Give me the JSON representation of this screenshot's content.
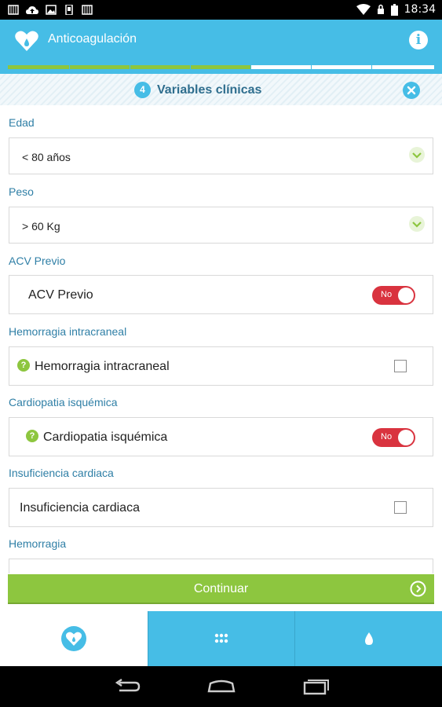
{
  "status_bar": {
    "time": "18:34"
  },
  "app_bar": {
    "title": "Anticoagulación"
  },
  "progress": {
    "total_steps": 7,
    "completed_steps": 4
  },
  "step": {
    "number": "4",
    "title": "Variables clínicas"
  },
  "fields": {
    "edad": {
      "label": "Edad",
      "value": "< 80 años"
    },
    "peso": {
      "label": "Peso",
      "value": "> 60 Kg"
    },
    "acv": {
      "label": "ACV Previo",
      "row_label": "ACV Previo",
      "toggle": "No"
    },
    "hemorragia_intracraneal": {
      "label": "Hemorragia intracraneal",
      "row_label": "Hemorragia intracraneal",
      "checked": false
    },
    "cardiopatia": {
      "label": "Cardiopatia isquémica",
      "row_label": "Cardiopatia isquémica",
      "toggle": "No"
    },
    "insuficiencia": {
      "label": "Insuficiencia cardiaca",
      "row_label": "Insuficiencia cardiaca",
      "checked": false
    },
    "hemorragia": {
      "label": "Hemorragia"
    }
  },
  "continue_button": {
    "label": "Continuar"
  },
  "help_glyph": "?",
  "info_glyph": "i",
  "colors": {
    "primary": "#46bde6",
    "accent_green": "#8dc63f",
    "toggle_off": "#d9333f",
    "label_blue": "#2f7fa6"
  },
  "icons": {
    "logo": "heart-drop-icon",
    "info": "info-icon",
    "close": "close-icon",
    "chevron": "chevron-down-icon",
    "help": "help-icon",
    "continue": "arrow-right-circle-icon",
    "tab_1": "heart-drop-icon",
    "tab_2": "grid-icon",
    "tab_3": "drop-icon"
  }
}
